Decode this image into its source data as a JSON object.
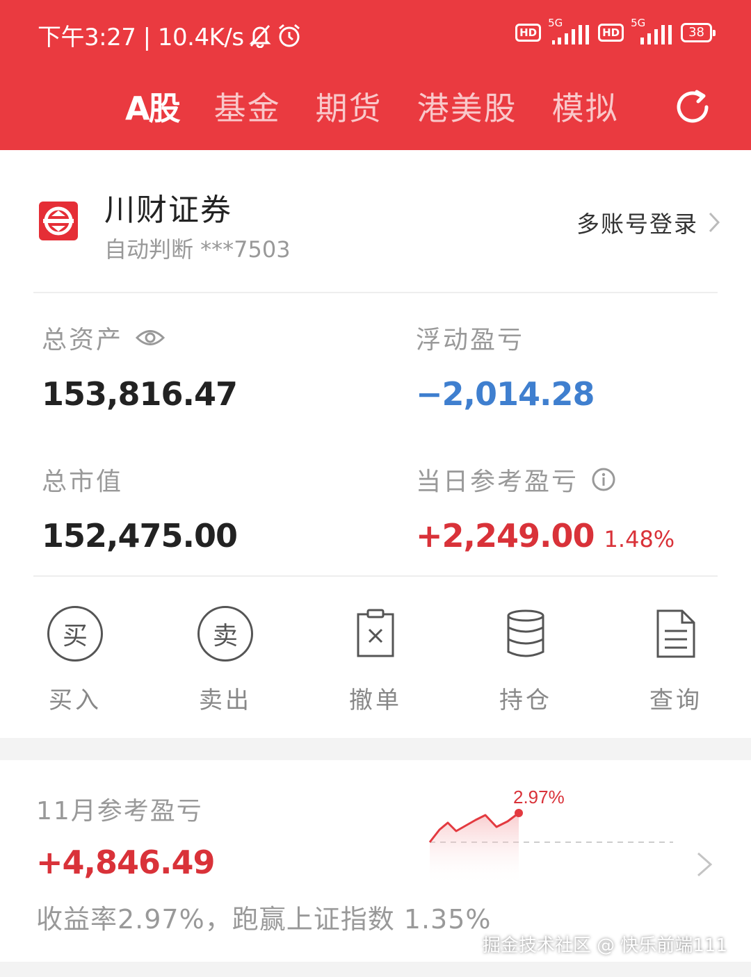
{
  "status_bar": {
    "time_speed": "下午3:27 | 10.4K/s",
    "hd1": "HD",
    "net1": "5G",
    "hd2": "HD",
    "net2": "5G",
    "battery": "38"
  },
  "tabs": [
    {
      "label": "A股",
      "active": true
    },
    {
      "label": "基金",
      "active": false
    },
    {
      "label": "期货",
      "active": false
    },
    {
      "label": "港美股",
      "active": false
    },
    {
      "label": "模拟",
      "active": false
    }
  ],
  "account": {
    "broker_name": "川财证券",
    "account_info": "自动判断 ***7503",
    "multi_login": "多账号登录"
  },
  "stats": {
    "total_assets_label": "总资产",
    "total_assets_value": "153,816.47",
    "floating_pl_label": "浮动盈亏",
    "floating_pl_value": "−2,014.28",
    "market_value_label": "总市值",
    "market_value_value": "152,475.00",
    "daily_pl_label": "当日参考盈亏",
    "daily_pl_value": "+2,249.00",
    "daily_pl_pct": "1.48%"
  },
  "actions": {
    "buy_glyph": "买",
    "buy_label": "买入",
    "sell_glyph": "卖",
    "sell_label": "卖出",
    "cancel_label": "撤单",
    "position_label": "持仓",
    "query_label": "查询"
  },
  "monthly": {
    "title": "11月参考盈亏",
    "value": "+4,846.49",
    "summary": "收益率2.97%，跑赢上证指数 1.35%",
    "chart_label": "2.97%"
  },
  "watermark": "掘金技术社区 @ 快乐前端111",
  "colors": {
    "header": "#ea3a40",
    "profit_red": "#d93239",
    "loss_blue": "#3f7fcf"
  }
}
